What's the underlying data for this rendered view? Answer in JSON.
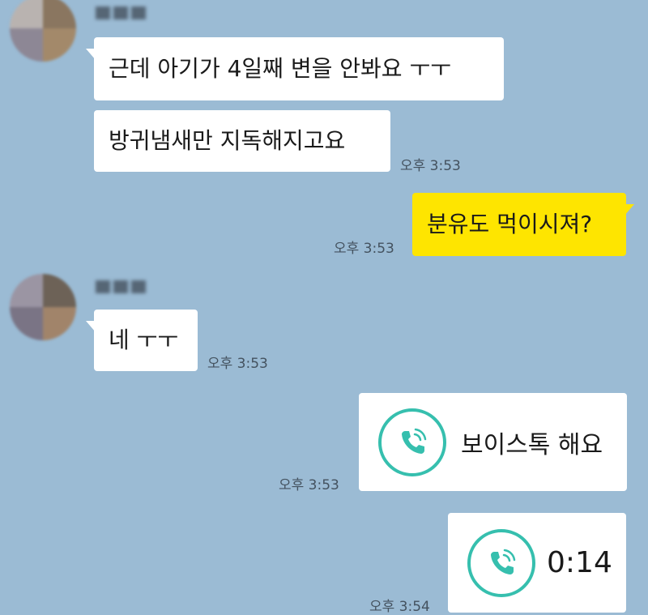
{
  "chat": {
    "senders": [
      {
        "name_obscured": true,
        "avatar_obscured": true
      },
      {
        "name_obscured": true,
        "avatar_obscured": true
      }
    ],
    "messages": [
      {
        "text": "근데 아기가 4일째 변을 안봐요 ㅜㅜ"
      },
      {
        "text": "방귀냄새만 지독해지고요",
        "time": "오후 3:53"
      },
      {
        "text": "분유도 먹이시져?",
        "time": "오후 3:53"
      },
      {
        "text": "네 ㅜㅜ",
        "time": "오후 3:53"
      }
    ],
    "voice_call": {
      "label": "보이스톡 해요",
      "time": "오후 3:53"
    },
    "call_duration": {
      "duration": "0:14",
      "time": "오후 3:54"
    }
  },
  "colors": {
    "background": "#9bbbd4",
    "incoming_bubble": "#ffffff",
    "outgoing_bubble": "#fee500",
    "call_accent": "#36bfae"
  },
  "icons": {
    "call": "phone-call-icon"
  }
}
